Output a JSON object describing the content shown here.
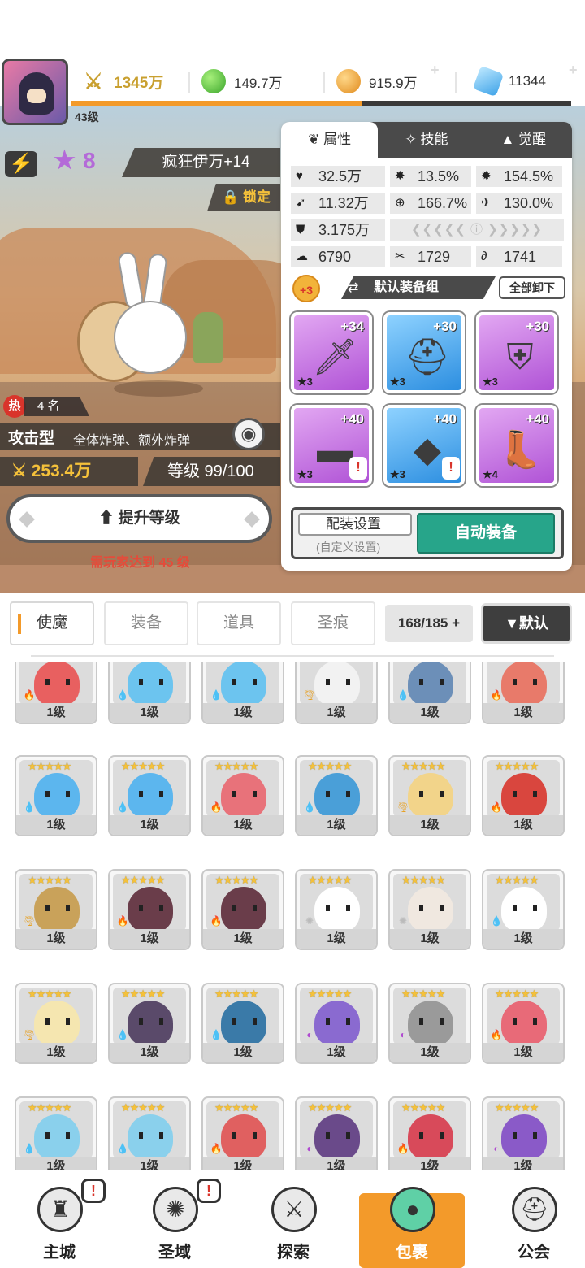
{
  "player": {
    "level": "43级",
    "xp_fraction": 0.58
  },
  "resources": {
    "power": "1345万",
    "green": "149.7万",
    "gold": "915.9万",
    "gems": "11344"
  },
  "hero": {
    "stars": "8",
    "name": "疯狂伊万+14",
    "lock": "锁定",
    "hot_rank": "4 名",
    "hot_icon": "热",
    "type": "攻击型",
    "desc": "全体炸弹、额外炸弹",
    "power": "253.4万",
    "level": "等级 99/100",
    "upgrade": "提升等级",
    "requirement": "需玩家达到 45 级"
  },
  "panel_tabs": [
    "属性",
    "技能",
    "觉醒"
  ],
  "stats": {
    "hp": "32.5万",
    "crit": "13.5%",
    "crit_dmg": "154.5%",
    "atk": "11.32万",
    "accuracy": "166.7%",
    "speed": "130.0%",
    "def": "3.175万",
    "s1": "6790",
    "s2": "1729",
    "s3": "1741"
  },
  "gearset": {
    "badge": "+3",
    "name": "默认装备组",
    "unload": "全部卸下"
  },
  "gear": [
    {
      "plus": "+34",
      "stars": "★3",
      "color": "purple",
      "icon": "sword-icon",
      "warn": false
    },
    {
      "plus": "+30",
      "stars": "★3",
      "color": "blue",
      "icon": "helmet-icon",
      "warn": false
    },
    {
      "plus": "+30",
      "stars": "★3",
      "color": "purple",
      "icon": "armor-icon",
      "warn": false
    },
    {
      "plus": "+40",
      "stars": "★3",
      "color": "purple",
      "icon": "belt-icon",
      "warn": true
    },
    {
      "plus": "+40",
      "stars": "★3",
      "color": "blue",
      "icon": "necklace-icon",
      "warn": true
    },
    {
      "plus": "+40",
      "stars": "★4",
      "color": "purple",
      "icon": "boots-icon",
      "warn": false
    }
  ],
  "setup": {
    "config": "配装设置",
    "custom": "(自定义设置)",
    "auto": "自动装备"
  },
  "inventory_tabs": [
    "使魔",
    "装备",
    "道具",
    "圣痕"
  ],
  "capacity": "168/185",
  "sort": "默认",
  "cards": {
    "level": "1级",
    "stars": "★★★★★",
    "rows": [
      [
        "#e86060",
        "#6cc4ef",
        "#6cc4ef",
        "#f2f2f2",
        "#6c8fb8",
        "#e87a6a"
      ],
      [
        "#5cb6ee",
        "#5cb6ee",
        "#e8727a",
        "#4a9fd8",
        "#f2d48a",
        "#d9463e"
      ],
      [
        "#c9a25a",
        "#6a3d4a",
        "#6a3d4a",
        "#ffffff",
        "#f0e8e0",
        "#ffffff"
      ],
      [
        "#f5e6b0",
        "#5a4a6a",
        "#3a7aa8",
        "#8a6ad0",
        "#9a9a9a",
        "#e86a78"
      ],
      [
        "#8ad0ec",
        "#8ad0ec",
        "#e06060",
        "#6a4a8a",
        "#d84a5a",
        "#8a5ac8"
      ]
    ],
    "elements": [
      [
        "fire",
        "water",
        "water",
        "wind",
        "water",
        "fire"
      ],
      [
        "water",
        "water",
        "fire",
        "water",
        "wind",
        "fire"
      ],
      [
        "wind",
        "fire",
        "fire",
        "light",
        "light",
        "water"
      ],
      [
        "wind",
        "water",
        "water",
        "dark",
        "dark",
        "fire"
      ],
      [
        "water",
        "water",
        "fire",
        "dark",
        "fire",
        "dark"
      ]
    ]
  },
  "nav": [
    "主城",
    "圣域",
    "探索",
    "包裹",
    "公会"
  ],
  "colors": {
    "accent": "#f39a2a",
    "auto_button": "#27a58a",
    "warning": "#e54b3a",
    "star": "#b46ad8"
  }
}
